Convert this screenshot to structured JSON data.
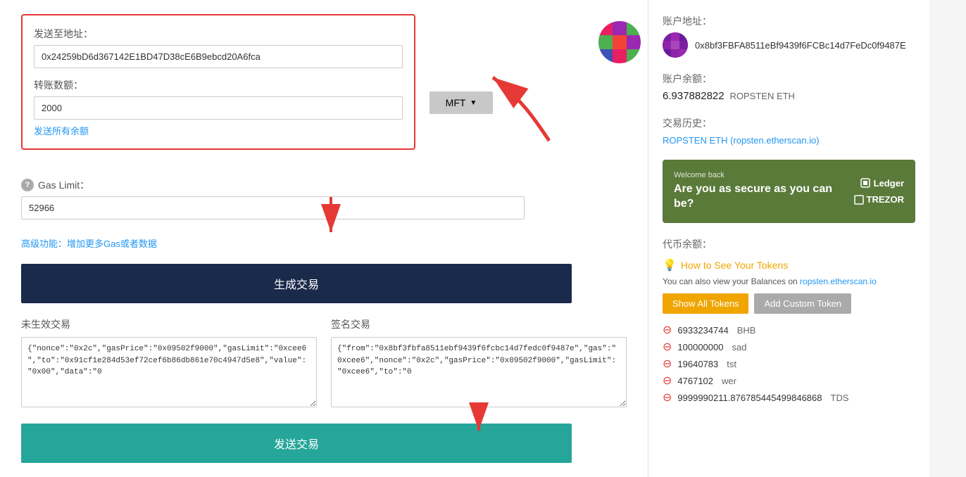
{
  "form": {
    "to_label": "发送至地址：",
    "to_address": "0x24259bD6d367142E1BD47D38cE6B9ebcd20A6fca",
    "amount_label": "转账数额：",
    "amount_value": "2000",
    "token_button": "MFT",
    "send_all_text": "发送所有余额",
    "gas_label": "Gas Limit：",
    "gas_value": "52966",
    "advanced_link": "高级功能：增加更多Gas或者数据",
    "generate_btn": "生成交易",
    "send_btn": "发送交易"
  },
  "unsigned_tx": {
    "title": "未生效交易",
    "content": "{\"nonce\":\"0x2c\",\"gasPrice\":\"0x09502f9000\",\"gasLimit\":\"0xcee6\",\"to\":\"0x91cf1e284d53ef72cef6b86db861e70c4947d5e8\",\"value\":\"0x00\",\"data\":\"0"
  },
  "signed_tx": {
    "title": "签名交易",
    "content": "{\"from\":\"0x8bf3fbfa8511ebf9439f6fcbc14d7fedc0f9487e\",\"gas\":\"0xcee6\",\"nonce\":\"0x2c\",\"gasPrice\":\"0x09502f9000\",\"gasLimit\":\"0xcee6\",\"to\":\"0"
  },
  "sidebar": {
    "account_label": "账户地址：",
    "account_address": "0x8bf3FBFA8511eBf9439f6FCBc14d7FeDc0f9487E",
    "balance_label": "账户余额：",
    "balance_amount": "6.937882822",
    "balance_unit": "ROPSTEN ETH",
    "tx_history_label": "交易历史：",
    "tx_history_link": "ROPSTEN ETH (ropsten.etherscan.io)",
    "security_banner": {
      "welcome": "Welcome back",
      "headline": "Are you as secure as you can be?",
      "ledger": "Ledger",
      "trezor": "TREZOR"
    },
    "token_balance_label": "代币余额：",
    "how_to_link": "How to See Your Tokens",
    "view_balance_text": "You can also view your Balances on",
    "view_balance_link": "ropsten.etherscan.io",
    "show_all_btn": "Show All Tokens",
    "add_custom_btn": "Add Custom Token",
    "tokens": [
      {
        "amount": "6933234744",
        "symbol": "BHB"
      },
      {
        "amount": "100000000",
        "symbol": "sad"
      },
      {
        "amount": "19640783",
        "symbol": "tst"
      },
      {
        "amount": "4767102",
        "symbol": "wer"
      },
      {
        "amount": "9999990211.876785445499846868",
        "symbol": "TDS"
      }
    ]
  }
}
